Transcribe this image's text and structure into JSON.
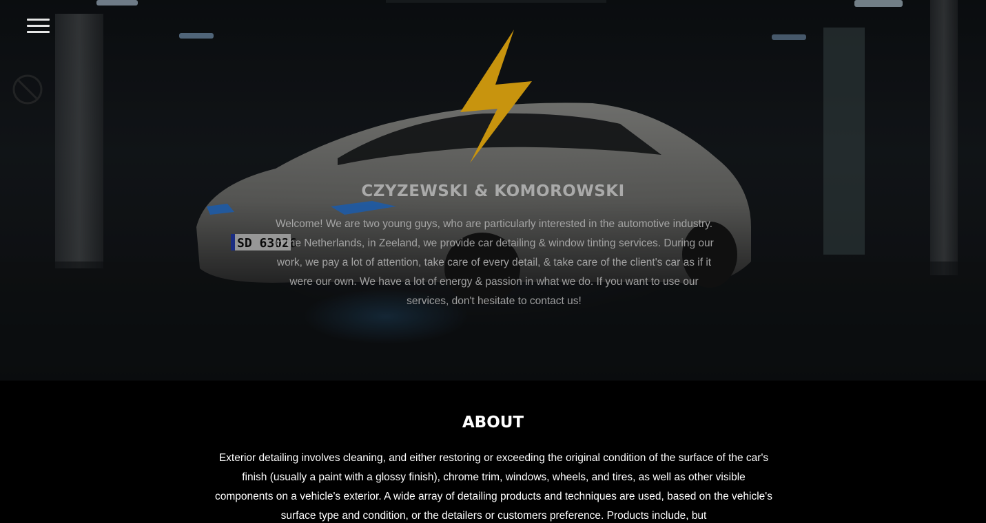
{
  "nav": {
    "menu_icon": "hamburger-menu-icon"
  },
  "hero": {
    "logo_icon": "lightning-bolt-icon",
    "logo_color": "#C8940E",
    "title": "CZYZEWSKI & KOMOROWSKI",
    "text": "Welcome! We are two young guys, who are particularly interested in the automotive industry. In the Netherlands, in Zeeland, we provide car detailing & window tinting services. During our work, we pay a lot of attention, take care of every detail, & take care of the client's car as if it were our own. We have a lot of energy & passion in what we do. If you want to use our services, don't hesitate to contact us!",
    "license_plate": "SD 63026"
  },
  "about": {
    "title": "ABOUT",
    "text": "Exterior detailing involves cleaning, and either restoring or exceeding the original condition of the surface of the car's finish (usually a paint with a glossy finish), chrome trim, windows, wheels, and tires, as well as other visible components on a vehicle's exterior. A wide array of detailing products and techniques are used, based on the vehicle's surface type and condition, or the detailers or customers preference. Products include, but"
  },
  "colors": {
    "background": "#000000",
    "accent": "#C8940E",
    "headlight_blue": "#2E8BFF"
  }
}
